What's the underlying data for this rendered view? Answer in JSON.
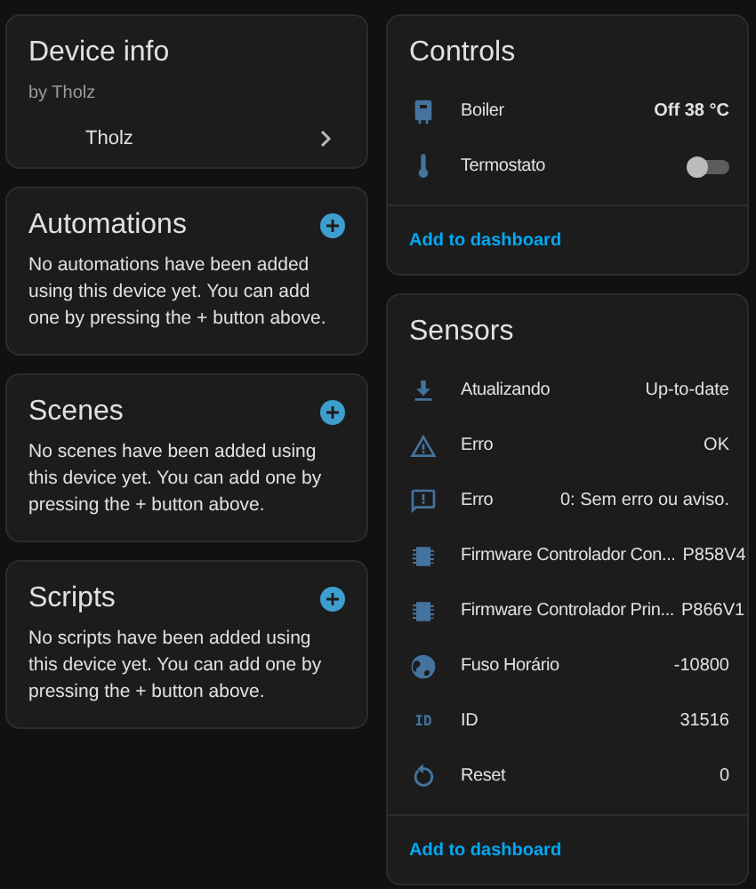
{
  "device_info": {
    "title": "Device info",
    "manufacturer": "by Tholz",
    "entry": {
      "label": "Tholz"
    }
  },
  "automations": {
    "title": "Automations",
    "message": "No automations have been added using this device yet. You can add one by pressing the + button above."
  },
  "scenes": {
    "title": "Scenes",
    "message": "No scenes have been added using this device yet. You can add one by pressing the + button above."
  },
  "scripts": {
    "title": "Scripts",
    "message": "No scripts have been added using this device yet. You can add one by pressing the + button above."
  },
  "controls": {
    "title": "Controls",
    "rows": [
      {
        "kind": "value",
        "name": "Boiler",
        "value": "Off 38 °C"
      },
      {
        "kind": "toggle",
        "name": "Termostato",
        "on": false
      }
    ],
    "action": "Add to dashboard"
  },
  "sensors": {
    "title": "Sensors",
    "rows": [
      {
        "kind": "download",
        "name": "Atualizando",
        "value": "Up-to-date"
      },
      {
        "kind": "warning",
        "name": "Erro",
        "value": "OK"
      },
      {
        "kind": "message",
        "name": "Erro",
        "value": "0: Sem erro ou aviso."
      },
      {
        "kind": "chip",
        "name": "Firmware Controlador Con...",
        "value": "P858V4"
      },
      {
        "kind": "chip",
        "name": "Firmware Controlador Prin...",
        "value": "P866V1"
      },
      {
        "kind": "globe",
        "name": "Fuso Horário",
        "value": "-10800"
      },
      {
        "kind": "text",
        "icon_text": "ID",
        "name": "ID",
        "value": "31516"
      },
      {
        "kind": "restart",
        "name": "Reset",
        "value": "0"
      }
    ],
    "action": "Add to dashboard"
  }
}
